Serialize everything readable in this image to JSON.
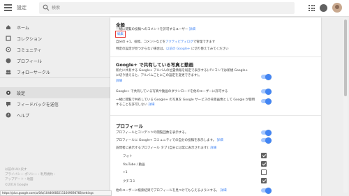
{
  "header": {
    "app_title": "設定",
    "search_placeholder": "検索"
  },
  "sidebar": {
    "items": [
      {
        "label": "ホーム",
        "icon": "home-icon"
      },
      {
        "label": "コレクション",
        "icon": "collection-icon"
      },
      {
        "label": "コミュニティ",
        "icon": "community-icon"
      },
      {
        "label": "プロフィール",
        "icon": "profile-icon"
      },
      {
        "label": "フォローサークル",
        "icon": "circles-icon"
      },
      {
        "label": "設定",
        "icon": "settings-icon",
        "active": true
      },
      {
        "label": "フィードバックを送信",
        "icon": "feedback-icon"
      },
      {
        "label": "ヘルプ",
        "icon": "help-icon"
      }
    ],
    "footer": {
      "line1": "以前のUIに戻す",
      "line2": "プライバシー ポリシー・利用規約・",
      "line3": "アップデート・地図",
      "line4": "©2016 Google"
    }
  },
  "sections": {
    "general": {
      "title": "全般",
      "desc": "一緒に閲覧の投稿へのコメントを許可するユーザー",
      "detail": "詳細",
      "edit_link": "編集",
      "plus1_text_pre": "自分の +1、投稿、コメントなどを",
      "plus1_link": "アクティビティログ",
      "plus1_text_post": "で管理できます",
      "old_settings_text": "特定の設定が見つからない場合は、",
      "old_settings_link": "以前の Google+",
      "old_settings_post": " に切り替えてみてください"
    },
    "photos": {
      "title": "Google+ で共有している写真と動画",
      "row1_line1": "新たに共有する Google+ アルバムの位置情報を既定で表示する(パソコンでは新規 Google+",
      "row1_line2": "に切り替えると、アルバムごとにこの設定を変更できます)。",
      "row1_detail": "詳細",
      "row2": "Google+ で共有している写真や動画のダウンロードを他のユーザーに許可する",
      "row3_line1": "一緒に閲覧で共有している Google+ の写真を Google サービスの背景画像として Google が使用",
      "row3_line2": "することを許可しない",
      "row3_detail": "詳細"
    },
    "profile": {
      "title": "プロフィール",
      "row1": "プロフィールとコンテンツの閲覧回数を表示する。",
      "row2_pre": "プロフィールに Google+ コミュニティでの自分の投稿を表示します。",
      "row2_detail": "詳細",
      "row3_pre": "訪問者に表示するプロフィール タブ (自分には常に表示されます):",
      "row3_detail": "詳細",
      "tabs": [
        {
          "label": "フォト",
          "checked": true
        },
        {
          "label": "YouTube / 動画",
          "checked": true
        },
        {
          "label": "+1",
          "checked": false
        },
        {
          "label": "クチコミ",
          "checked": true
        }
      ],
      "row4_pre": "他のユーザーに検索結果でプロフィールを見つけてもらえるようにする。",
      "row4_detail": "詳細"
    }
  },
  "statusbar": {
    "url": "https://plus.google.com/u/0/b/104466682111609698768/settings"
  }
}
